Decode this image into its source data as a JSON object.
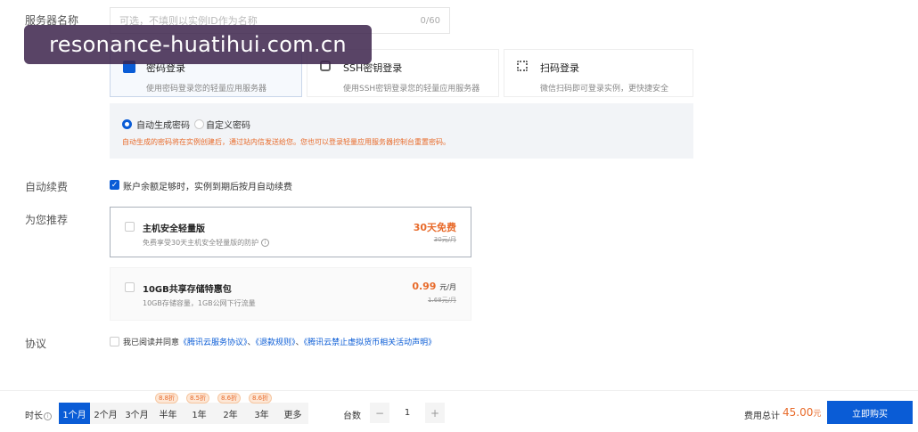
{
  "server_name": {
    "label": "服务器名称",
    "placeholder": "可选，不填则以实例ID作为名称",
    "counter": "0/60"
  },
  "watermark": "resonance-huatihui.com.cn",
  "login_methods": [
    {
      "title": "密码登录",
      "desc": "使用密码登录您的轻量应用服务器"
    },
    {
      "title": "SSH密钥登录",
      "desc": "使用SSH密钥登录您的轻量应用服务器"
    },
    {
      "title": "扫码登录",
      "desc": "微信扫码即可登录实例，更快捷安全"
    }
  ],
  "password": {
    "auto": "自动生成密码",
    "custom": "自定义密码",
    "hint": "自动生成的密码将在实例创建后，通过站内信发送给您。您也可以登录轻量应用服务器控制台重置密码。"
  },
  "auto_renew": {
    "label": "自动续费",
    "text": "账户余额足够时，实例到期后按月自动续费"
  },
  "recommend": {
    "label": "为您推荐",
    "items": [
      {
        "title": "主机安全轻量版",
        "desc": "免费享受30天主机安全轻量版的防护",
        "price": "30天免费",
        "orig": "30元/月"
      },
      {
        "title": "10GB共享存储特惠包",
        "desc": "10GB存储容量，1GB公网下行流量",
        "price": "0.99",
        "unit": "元/月",
        "orig": "1.68元/月"
      }
    ]
  },
  "agreement": {
    "label": "协议",
    "prefix": "我已阅读并同意",
    "link1": "《腾讯云服务协议》",
    "sep1": "、",
    "link2": "《退款规则》",
    "sep2": "、",
    "link3": "《腾讯云禁止虚拟货币相关活动声明》"
  },
  "bottom": {
    "duration_label": "时长",
    "durations": [
      {
        "label": "1个月",
        "badge": ""
      },
      {
        "label": "2个月",
        "badge": ""
      },
      {
        "label": "3个月",
        "badge": ""
      },
      {
        "label": "半年",
        "badge": "8.8折"
      },
      {
        "label": "1年",
        "badge": "8.5折"
      },
      {
        "label": "2年",
        "badge": "8.6折"
      },
      {
        "label": "3年",
        "badge": "8.6折"
      },
      {
        "label": "更多",
        "badge": ""
      }
    ],
    "qty_label": "台数",
    "qty_minus": "−",
    "qty_value": "1",
    "qty_plus": "+",
    "total_label": "费用总计",
    "total_value": "45.00",
    "total_unit": "元",
    "buy_label": "立即购买"
  },
  "colors": {
    "primary": "#0a5cd6",
    "accent": "#e86b2b"
  }
}
